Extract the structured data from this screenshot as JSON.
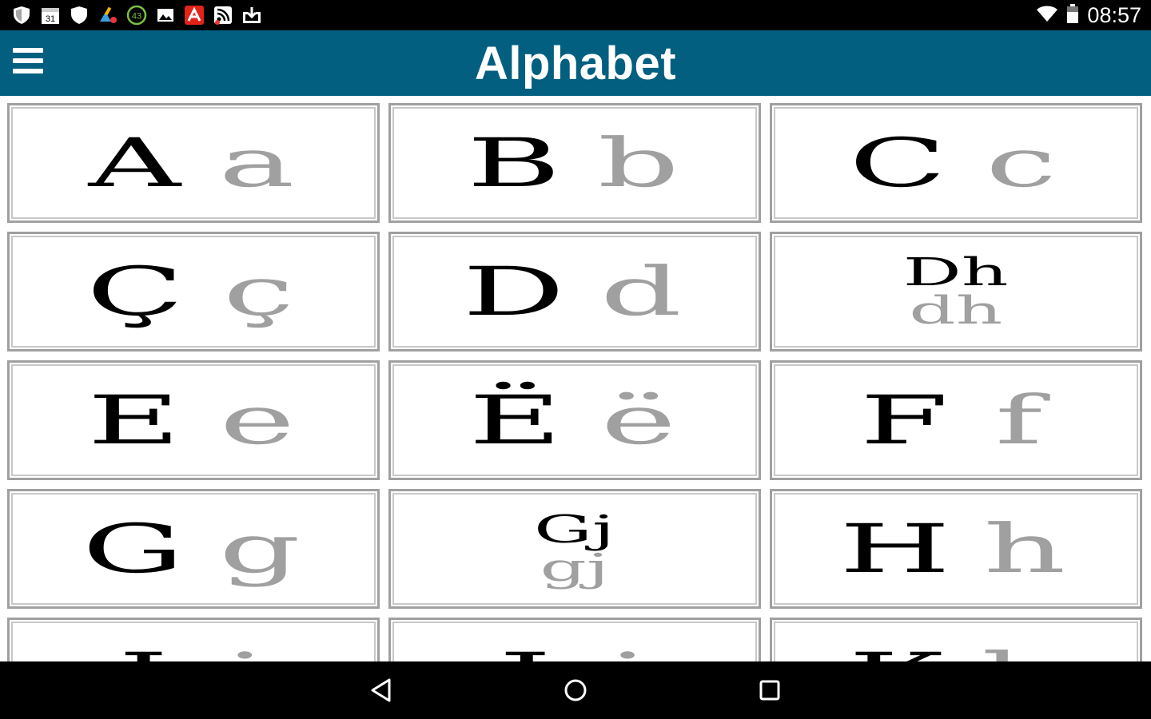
{
  "status_bar": {
    "time": "08:57",
    "icons": [
      "shield-icon",
      "calendar-icon",
      "shield-icon",
      "cleaner-icon",
      "battery-saver-icon",
      "image-icon",
      "avira-icon",
      "rss-icon",
      "download-icon"
    ],
    "calendar_day": "31",
    "badge_count": "43"
  },
  "app_bar": {
    "title": "Alphabet",
    "menu_icon": "hamburger-menu-icon",
    "color": "#035f80"
  },
  "letters": [
    {
      "upper": "A",
      "lower": "a"
    },
    {
      "upper": "B",
      "lower": "b"
    },
    {
      "upper": "C",
      "lower": "c"
    },
    {
      "upper": "Ç",
      "lower": "ç"
    },
    {
      "upper": "D",
      "lower": "d"
    },
    {
      "upper": "Dh",
      "lower": "dh"
    },
    {
      "upper": "E",
      "lower": "e"
    },
    {
      "upper": "Ë",
      "lower": "ë"
    },
    {
      "upper": "F",
      "lower": "f"
    },
    {
      "upper": "G",
      "lower": "g"
    },
    {
      "upper": "Gj",
      "lower": "gj"
    },
    {
      "upper": "H",
      "lower": "h"
    },
    {
      "upper": "I",
      "lower": "i"
    },
    {
      "upper": "J",
      "lower": "j"
    },
    {
      "upper": "K",
      "lower": "k"
    }
  ],
  "nav_bar": {
    "back_icon": "back-triangle-icon",
    "home_icon": "home-circle-icon",
    "recents_icon": "recents-square-icon"
  }
}
